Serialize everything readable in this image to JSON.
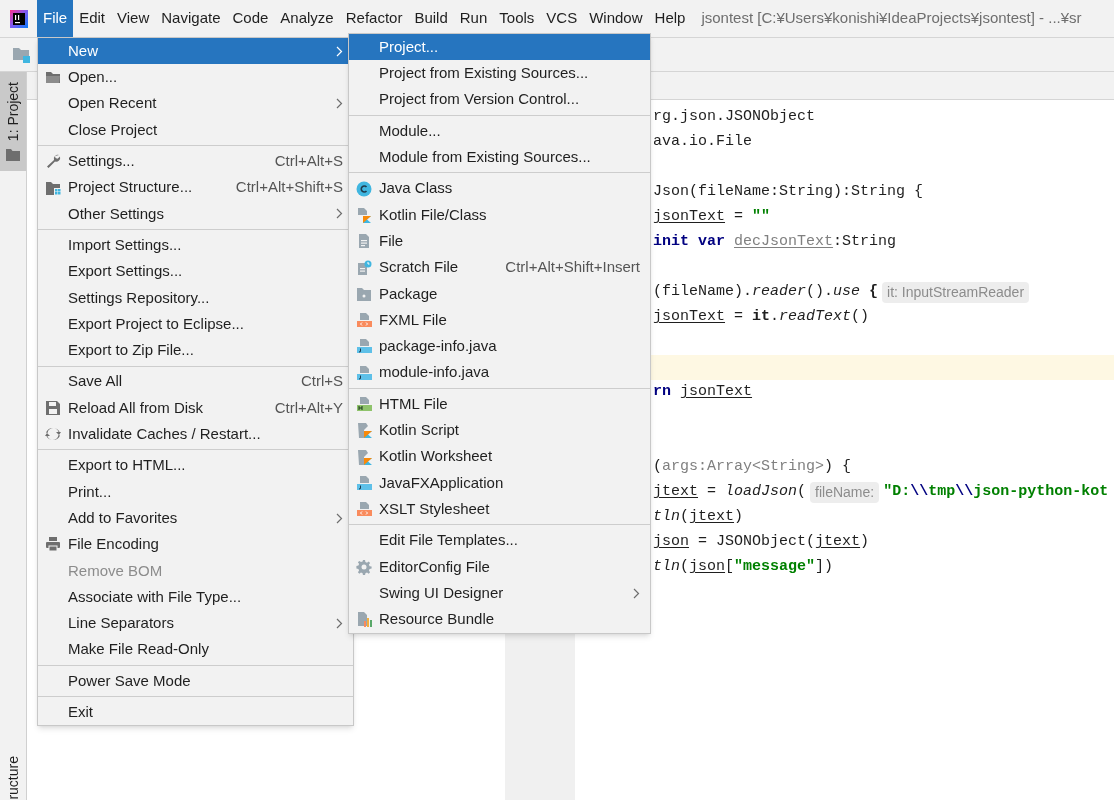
{
  "menubar": {
    "items": [
      {
        "label": "File",
        "selected": true
      },
      {
        "label": "Edit",
        "selected": false
      },
      {
        "label": "View",
        "selected": false
      },
      {
        "label": "Navigate",
        "selected": false
      },
      {
        "label": "Code",
        "selected": false
      },
      {
        "label": "Analyze",
        "selected": false
      },
      {
        "label": "Refactor",
        "selected": false
      },
      {
        "label": "Build",
        "selected": false
      },
      {
        "label": "Run",
        "selected": false
      },
      {
        "label": "Tools",
        "selected": false
      },
      {
        "label": "VCS",
        "selected": false
      },
      {
        "label": "Window",
        "selected": false
      },
      {
        "label": "Help",
        "selected": false
      }
    ],
    "title": "jsontest [C:¥Users¥konishi¥IdeaProjects¥jsontest] - ...¥sr"
  },
  "tool_stripe": {
    "tabs": [
      {
        "label": "1: Project",
        "selected": true
      }
    ],
    "bottom_label": "ructure"
  },
  "file_menu": {
    "groups": [
      {
        "items": [
          {
            "label": "New",
            "selected": true,
            "submenu": true,
            "disabled": false
          },
          {
            "label": "Open...",
            "selected": false,
            "submenu": false,
            "disabled": false
          },
          {
            "label": "Open Recent",
            "selected": false,
            "submenu": true,
            "disabled": false
          },
          {
            "label": "Close Project",
            "selected": false,
            "submenu": false,
            "disabled": false
          }
        ]
      },
      {
        "items": [
          {
            "label": "Settings...",
            "shortcut": "Ctrl+Alt+S",
            "selected": false,
            "submenu": false,
            "disabled": false
          },
          {
            "label": "Project Structure...",
            "shortcut": "Ctrl+Alt+Shift+S",
            "selected": false,
            "submenu": false,
            "disabled": false
          },
          {
            "label": "Other Settings",
            "selected": false,
            "submenu": true,
            "disabled": false
          }
        ]
      },
      {
        "items": [
          {
            "label": "Import Settings...",
            "selected": false,
            "submenu": false,
            "disabled": false
          },
          {
            "label": "Export Settings...",
            "selected": false,
            "submenu": false,
            "disabled": false
          },
          {
            "label": "Settings Repository...",
            "selected": false,
            "submenu": false,
            "disabled": false
          },
          {
            "label": "Export Project to Eclipse...",
            "selected": false,
            "submenu": false,
            "disabled": false
          },
          {
            "label": "Export to Zip File...",
            "selected": false,
            "submenu": false,
            "disabled": false
          }
        ]
      },
      {
        "items": [
          {
            "label": "Save All",
            "shortcut": "Ctrl+S",
            "selected": false,
            "submenu": false,
            "disabled": false
          },
          {
            "label": "Reload All from Disk",
            "shortcut": "Ctrl+Alt+Y",
            "selected": false,
            "submenu": false,
            "disabled": false
          },
          {
            "label": "Invalidate Caches / Restart...",
            "selected": false,
            "submenu": false,
            "disabled": false
          }
        ]
      },
      {
        "items": [
          {
            "label": "Export to HTML...",
            "selected": false,
            "submenu": false,
            "disabled": false
          },
          {
            "label": "Print...",
            "selected": false,
            "submenu": false,
            "disabled": false
          },
          {
            "label": "Add to Favorites",
            "selected": false,
            "submenu": true,
            "disabled": false
          },
          {
            "label": "File Encoding",
            "selected": false,
            "submenu": false,
            "disabled": false
          },
          {
            "label": "Remove BOM",
            "selected": false,
            "submenu": false,
            "disabled": true
          },
          {
            "label": "Associate with File Type...",
            "selected": false,
            "submenu": false,
            "disabled": false
          },
          {
            "label": "Line Separators",
            "selected": false,
            "submenu": true,
            "disabled": false
          },
          {
            "label": "Make File Read-Only",
            "selected": false,
            "submenu": false,
            "disabled": false
          }
        ]
      },
      {
        "items": [
          {
            "label": "Power Save Mode",
            "selected": false,
            "submenu": false,
            "disabled": false
          }
        ]
      },
      {
        "items": [
          {
            "label": "Exit",
            "selected": false,
            "submenu": false,
            "disabled": false
          }
        ]
      }
    ]
  },
  "new_submenu": {
    "groups": [
      {
        "items": [
          {
            "label": "Project...",
            "selected": true,
            "submenu": false
          },
          {
            "label": "Project from Existing Sources...",
            "selected": false,
            "submenu": false
          },
          {
            "label": "Project from Version Control...",
            "selected": false,
            "submenu": false
          }
        ]
      },
      {
        "items": [
          {
            "label": "Module...",
            "selected": false,
            "submenu": false
          },
          {
            "label": "Module from Existing Sources...",
            "selected": false,
            "submenu": false
          }
        ]
      },
      {
        "items": [
          {
            "label": "Java Class",
            "selected": false,
            "submenu": false
          },
          {
            "label": "Kotlin File/Class",
            "selected": false,
            "submenu": false
          },
          {
            "label": "File",
            "selected": false,
            "submenu": false
          },
          {
            "label": "Scratch File",
            "shortcut": "Ctrl+Alt+Shift+Insert",
            "selected": false,
            "submenu": false
          },
          {
            "label": "Package",
            "selected": false,
            "submenu": false
          },
          {
            "label": "FXML File",
            "selected": false,
            "submenu": false
          },
          {
            "label": "package-info.java",
            "selected": false,
            "submenu": false
          },
          {
            "label": "module-info.java",
            "selected": false,
            "submenu": false
          }
        ]
      },
      {
        "items": [
          {
            "label": "HTML File",
            "selected": false,
            "submenu": false
          },
          {
            "label": "Kotlin Script",
            "selected": false,
            "submenu": false
          },
          {
            "label": "Kotlin Worksheet",
            "selected": false,
            "submenu": false
          },
          {
            "label": "JavaFXApplication",
            "selected": false,
            "submenu": false
          },
          {
            "label": "XSLT Stylesheet",
            "selected": false,
            "submenu": false
          }
        ]
      },
      {
        "items": [
          {
            "label": "Edit File Templates...",
            "selected": false,
            "submenu": false
          },
          {
            "label": "EditorConfig File",
            "selected": false,
            "submenu": false
          },
          {
            "label": "Swing UI Designer",
            "selected": false,
            "submenu": true
          },
          {
            "label": "Resource Bundle",
            "selected": false,
            "submenu": false
          }
        ]
      }
    ]
  },
  "editor": {
    "lines": [
      {
        "current": false,
        "tokens": [
          {
            "kind": "plain",
            "text": "rg.json.JSONObject"
          }
        ]
      },
      {
        "current": false,
        "tokens": [
          {
            "kind": "plain",
            "text": "ava.io.File"
          }
        ]
      },
      {
        "current": false
      },
      {
        "current": false,
        "tokens": [
          {
            "kind": "plain",
            "text": "Json(fileName:String):String {"
          }
        ]
      },
      {
        "current": false,
        "tokens": [
          {
            "kind": "var",
            "text": "jsonText"
          },
          {
            "kind": "plain",
            "text": " = "
          },
          {
            "kind": "string",
            "text": "\"\""
          }
        ]
      },
      {
        "current": false,
        "tokens": [
          {
            "kind": "keyword",
            "text": "init var "
          },
          {
            "kind": "unused",
            "text": "decJsonText"
          },
          {
            "kind": "plain",
            "text": ":String"
          }
        ]
      },
      {
        "current": false
      },
      {
        "current": false,
        "tokens": [
          {
            "kind": "plain",
            "text": "(fileName)."
          },
          {
            "kind": "call",
            "text": "reader"
          },
          {
            "kind": "plain",
            "text": "()."
          },
          {
            "kind": "call",
            "text": "use"
          },
          {
            "kind": "bold",
            "text": " {"
          },
          {
            "kind": "hint",
            "text": "it: InputStreamReader"
          }
        ]
      },
      {
        "current": false,
        "tokens": [
          {
            "kind": "var",
            "text": "jsonText"
          },
          {
            "kind": "plain",
            "text": " = "
          },
          {
            "kind": "bold",
            "text": "it"
          },
          {
            "kind": "plain",
            "text": "."
          },
          {
            "kind": "call",
            "text": "readText"
          },
          {
            "kind": "plain",
            "text": "()"
          }
        ]
      },
      {
        "current": false
      },
      {
        "current": true
      },
      {
        "current": false,
        "tokens": [
          {
            "kind": "keyword",
            "text": "rn "
          },
          {
            "kind": "var",
            "text": "jsonText"
          }
        ]
      },
      {
        "current": false
      },
      {
        "current": false
      },
      {
        "current": false,
        "tokens": [
          {
            "kind": "plain",
            "text": "("
          },
          {
            "kind": "param",
            "text": "args:Array<String>"
          },
          {
            "kind": "plain",
            "text": ") {"
          }
        ]
      },
      {
        "current": false,
        "tokens": [
          {
            "kind": "var",
            "text": "jtext"
          },
          {
            "kind": "plain",
            "text": " = "
          },
          {
            "kind": "call",
            "text": "loadJson"
          },
          {
            "kind": "plain",
            "text": "("
          },
          {
            "kind": "hint",
            "text": "fileName:"
          },
          {
            "kind": "string",
            "text": "\"D:"
          },
          {
            "kind": "escape",
            "text": "\\\\"
          },
          {
            "kind": "string",
            "text": "tmp"
          },
          {
            "kind": "escape",
            "text": "\\\\"
          },
          {
            "kind": "string",
            "text": "json-python-kot"
          }
        ]
      },
      {
        "current": false,
        "tokens": [
          {
            "kind": "call",
            "text": "tln"
          },
          {
            "kind": "plain",
            "text": "("
          },
          {
            "kind": "var",
            "text": "jtext"
          },
          {
            "kind": "plain",
            "text": ")"
          }
        ]
      },
      {
        "current": false,
        "tokens": [
          {
            "kind": "var",
            "text": "json"
          },
          {
            "kind": "plain",
            "text": " = JSONObject("
          },
          {
            "kind": "var",
            "text": "jtext"
          },
          {
            "kind": "plain",
            "text": ")"
          }
        ]
      },
      {
        "current": false,
        "tokens": [
          {
            "kind": "call",
            "text": "tln"
          },
          {
            "kind": "plain",
            "text": "("
          },
          {
            "kind": "var",
            "text": "json"
          },
          {
            "kind": "plain",
            "text": "["
          },
          {
            "kind": "string",
            "text": "\"message\""
          },
          {
            "kind": "plain",
            "text": "])"
          }
        ]
      }
    ]
  }
}
